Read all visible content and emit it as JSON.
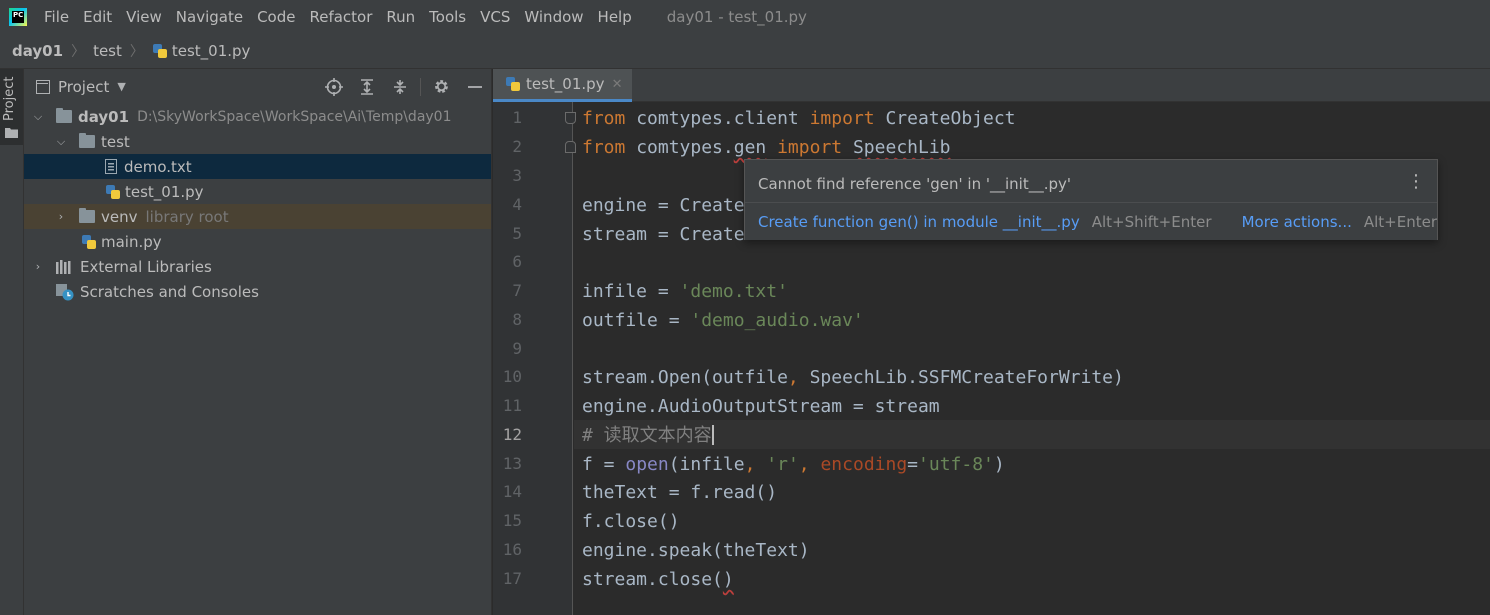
{
  "window_title": "day01 - test_01.py",
  "app_logo_text": "PC",
  "menu": [
    "File",
    "Edit",
    "View",
    "Navigate",
    "Code",
    "Refactor",
    "Run",
    "Tools",
    "VCS",
    "Window",
    "Help"
  ],
  "breadcrumb": [
    "day01",
    "test",
    "test_01.py"
  ],
  "tool_stripe": {
    "project_tab": "Project"
  },
  "project_panel": {
    "title": "Project",
    "tree": {
      "root_name": "day01",
      "root_path": "D:\\SkyWorkSpace\\WorkSpace\\Ai\\Temp\\day01",
      "test_folder": "test",
      "demo_txt": "demo.txt",
      "test_py": "test_01.py",
      "venv": "venv",
      "venv_note": "library root",
      "main_py": "main.py",
      "external_libraries": "External Libraries",
      "scratches": "Scratches and Consoles"
    }
  },
  "editor": {
    "tab_label": "test_01.py",
    "current_line": 12,
    "line_numbers": [
      "1",
      "2",
      "3",
      "4",
      "5",
      "6",
      "7",
      "8",
      "9",
      "10",
      "11",
      "12",
      "13",
      "14",
      "15",
      "16",
      "17"
    ],
    "code": {
      "l1_from": "from",
      "l1_mod": " comtypes.client ",
      "l1_import": "import",
      "l1_name": " CreateObject",
      "l2_from": "from",
      "l2_mod_a": " comtypes.",
      "l2_mod_b": "gen",
      "l2_sp": " ",
      "l2_import": "import",
      "l2_sp2": " ",
      "l2_name": "SpeechLib",
      "l4": "engine = Create",
      "l5": "stream = Create",
      "l7_a": "infile = ",
      "l7_b": "'demo.txt'",
      "l8_a": "outfile = ",
      "l8_b": "'demo_audio.wav'",
      "l10_a": "stream.Open(outfile",
      "l10_b": ",",
      "l10_c": " SpeechLib.SSFMCreateForWrite)",
      "l11": "engine.AudioOutputStream = stream",
      "l12": "# 读取文本内容",
      "l13_a": "f = ",
      "l13_b": "open",
      "l13_c": "(infile",
      "l13_d": ", ",
      "l13_e": "'r'",
      "l13_f": ", ",
      "l13_g": "encoding",
      "l13_h": "=",
      "l13_i": "'utf-8'",
      "l13_j": ")",
      "l14": "theText = f.read()",
      "l15": "f.close()",
      "l16": "engine.speak(theText)",
      "l17_a": "stream.close(",
      "l17_b": ")"
    }
  },
  "popup": {
    "message": "Cannot find reference 'gen' in '__init__.py'",
    "action": "Create function gen() in module __init__.py",
    "action_shortcut": "Alt+Shift+Enter",
    "more": "More actions...",
    "more_shortcut": "Alt+Enter"
  },
  "colors": {
    "keyword": "#cc7832",
    "string": "#6a8759",
    "builtin": "#8888c6",
    "param": "#aa4926",
    "comment": "#808080",
    "link": "#589df6",
    "selection": "#0d293e"
  }
}
